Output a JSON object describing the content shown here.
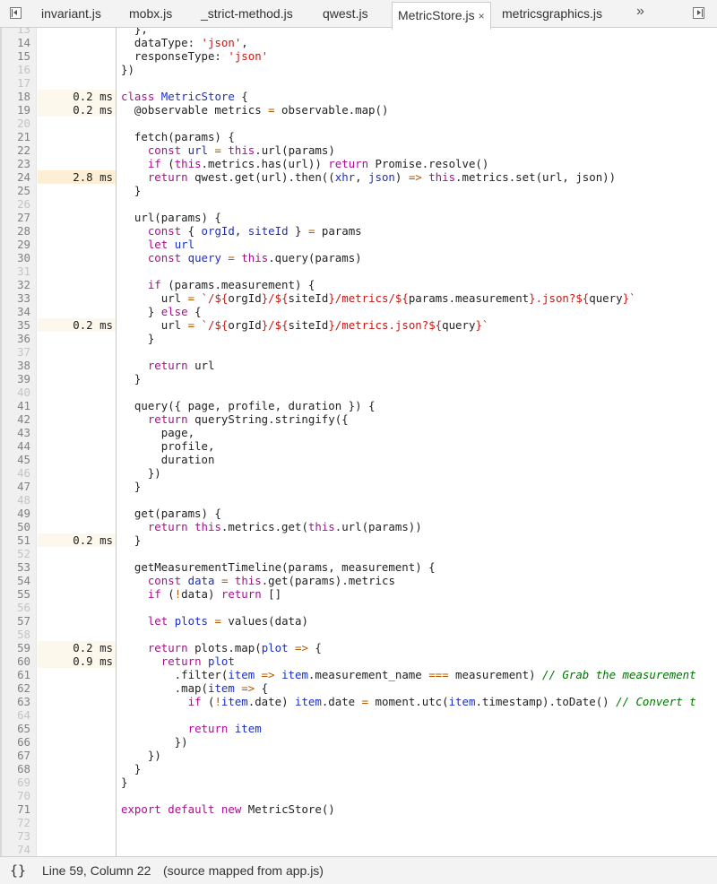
{
  "tabs": {
    "items": [
      {
        "label": "invariant.js",
        "active": false
      },
      {
        "label": "mobx.js",
        "active": false
      },
      {
        "label": "_strict-method.js",
        "active": false
      },
      {
        "label": "qwest.js",
        "active": false
      },
      {
        "label": "MetricStore.js",
        "active": true,
        "close": "×"
      },
      {
        "label": "metricsgraphics.js",
        "active": false
      }
    ],
    "more": "»"
  },
  "colors": {
    "keyword": "#aa0d91",
    "definition": "#1c2fbf",
    "string": "#c41a16",
    "operator": "#b35a00",
    "comment": "#007400",
    "hot_timing": "#fcefd6",
    "warm_timing": "#fdf8ec"
  },
  "code": {
    "lines": [
      {
        "n": "13",
        "dim": true,
        "t": [
          [
            "p",
            "  },"
          ]
        ]
      },
      {
        "n": "14",
        "t": [
          [
            "p",
            "  dataType: "
          ],
          [
            "s",
            "'json'"
          ],
          [
            "p",
            ","
          ]
        ]
      },
      {
        "n": "15",
        "t": [
          [
            "p",
            "  responseType: "
          ],
          [
            "s",
            "'json'"
          ]
        ]
      },
      {
        "n": "16",
        "dim": true,
        "t": [
          [
            "p",
            "})"
          ]
        ]
      },
      {
        "n": "17",
        "dim": true,
        "t": []
      },
      {
        "n": "18",
        "time": "0.2 ms",
        "heat": 1,
        "t": [
          [
            "k",
            "class"
          ],
          [
            "p",
            " "
          ],
          [
            "d",
            "MetricStore"
          ],
          [
            "p",
            " {"
          ]
        ]
      },
      {
        "n": "19",
        "time": "0.2 ms",
        "heat": 1,
        "t": [
          [
            "p",
            "  @observable metrics "
          ],
          [
            "o",
            "="
          ],
          [
            "p",
            " observable.map()"
          ]
        ]
      },
      {
        "n": "20",
        "dim": true,
        "t": []
      },
      {
        "n": "21",
        "t": [
          [
            "p",
            "  fetch(params) {"
          ]
        ]
      },
      {
        "n": "22",
        "t": [
          [
            "p",
            "    "
          ],
          [
            "k",
            "const"
          ],
          [
            "p",
            " "
          ],
          [
            "d",
            "url"
          ],
          [
            "p",
            " "
          ],
          [
            "o",
            "="
          ],
          [
            "p",
            " "
          ],
          [
            "k",
            "this"
          ],
          [
            "p",
            ".url(params)"
          ]
        ]
      },
      {
        "n": "23",
        "t": [
          [
            "p",
            "    "
          ],
          [
            "k",
            "if"
          ],
          [
            "p",
            " ("
          ],
          [
            "k",
            "this"
          ],
          [
            "p",
            ".metrics.has(url)) "
          ],
          [
            "k",
            "return"
          ],
          [
            "p",
            " Promise.resolve()"
          ]
        ]
      },
      {
        "n": "24",
        "time": "2.8 ms",
        "heat": 2,
        "t": [
          [
            "p",
            "    "
          ],
          [
            "k",
            "return"
          ],
          [
            "p",
            " qwest.get(url).then(("
          ],
          [
            "d",
            "xhr"
          ],
          [
            "p",
            ", "
          ],
          [
            "d",
            "json"
          ],
          [
            "p",
            ") "
          ],
          [
            "o",
            "=>"
          ],
          [
            "p",
            " "
          ],
          [
            "k",
            "this"
          ],
          [
            "p",
            ".metrics.set(url, json))"
          ]
        ]
      },
      {
        "n": "25",
        "t": [
          [
            "p",
            "  }"
          ]
        ]
      },
      {
        "n": "26",
        "dim": true,
        "t": []
      },
      {
        "n": "27",
        "t": [
          [
            "p",
            "  url(params) {"
          ]
        ]
      },
      {
        "n": "28",
        "t": [
          [
            "p",
            "    "
          ],
          [
            "k",
            "const"
          ],
          [
            "p",
            " { "
          ],
          [
            "d",
            "orgId"
          ],
          [
            "p",
            ", "
          ],
          [
            "d",
            "siteId"
          ],
          [
            "p",
            " } "
          ],
          [
            "o",
            "="
          ],
          [
            "p",
            " params"
          ]
        ]
      },
      {
        "n": "29",
        "t": [
          [
            "p",
            "    "
          ],
          [
            "k",
            "let"
          ],
          [
            "p",
            " "
          ],
          [
            "d",
            "url"
          ]
        ]
      },
      {
        "n": "30",
        "t": [
          [
            "p",
            "    "
          ],
          [
            "k",
            "const"
          ],
          [
            "p",
            " "
          ],
          [
            "d",
            "query"
          ],
          [
            "p",
            " "
          ],
          [
            "o",
            "="
          ],
          [
            "p",
            " "
          ],
          [
            "k",
            "this"
          ],
          [
            "p",
            ".query(params)"
          ]
        ]
      },
      {
        "n": "31",
        "dim": true,
        "t": []
      },
      {
        "n": "32",
        "t": [
          [
            "p",
            "    "
          ],
          [
            "k",
            "if"
          ],
          [
            "p",
            " (params.measurement) {"
          ]
        ]
      },
      {
        "n": "33",
        "t": [
          [
            "p",
            "      url "
          ],
          [
            "o",
            "="
          ],
          [
            "p",
            " "
          ],
          [
            "s",
            "`/${"
          ],
          [
            "p",
            "orgId"
          ],
          [
            "s",
            "}/${"
          ],
          [
            "p",
            "siteId"
          ],
          [
            "s",
            "}/metrics/${"
          ],
          [
            "p",
            "params.measurement"
          ],
          [
            "s",
            "}.json?${"
          ],
          [
            "p",
            "query"
          ],
          [
            "s",
            "}`"
          ]
        ]
      },
      {
        "n": "34",
        "t": [
          [
            "p",
            "    } "
          ],
          [
            "k",
            "else"
          ],
          [
            "p",
            " {"
          ]
        ]
      },
      {
        "n": "35",
        "time": "0.2 ms",
        "heat": 1,
        "t": [
          [
            "p",
            "      url "
          ],
          [
            "o",
            "="
          ],
          [
            "p",
            " "
          ],
          [
            "s",
            "`/${"
          ],
          [
            "p",
            "orgId"
          ],
          [
            "s",
            "}/${"
          ],
          [
            "p",
            "siteId"
          ],
          [
            "s",
            "}/metrics.json?${"
          ],
          [
            "p",
            "query"
          ],
          [
            "s",
            "}`"
          ]
        ]
      },
      {
        "n": "36",
        "t": [
          [
            "p",
            "    }"
          ]
        ]
      },
      {
        "n": "37",
        "dim": true,
        "t": []
      },
      {
        "n": "38",
        "t": [
          [
            "p",
            "    "
          ],
          [
            "k",
            "return"
          ],
          [
            "p",
            " url"
          ]
        ]
      },
      {
        "n": "39",
        "t": [
          [
            "p",
            "  }"
          ]
        ]
      },
      {
        "n": "40",
        "dim": true,
        "t": []
      },
      {
        "n": "41",
        "t": [
          [
            "p",
            "  query({ page, profile, duration }) {"
          ]
        ]
      },
      {
        "n": "42",
        "t": [
          [
            "p",
            "    "
          ],
          [
            "k",
            "return"
          ],
          [
            "p",
            " queryString.stringify({"
          ]
        ]
      },
      {
        "n": "43",
        "t": [
          [
            "p",
            "      page,"
          ]
        ]
      },
      {
        "n": "44",
        "t": [
          [
            "p",
            "      profile,"
          ]
        ]
      },
      {
        "n": "45",
        "t": [
          [
            "p",
            "      duration"
          ]
        ]
      },
      {
        "n": "46",
        "dim": true,
        "t": [
          [
            "p",
            "    })"
          ]
        ]
      },
      {
        "n": "47",
        "t": [
          [
            "p",
            "  }"
          ]
        ]
      },
      {
        "n": "48",
        "dim": true,
        "t": []
      },
      {
        "n": "49",
        "t": [
          [
            "p",
            "  get(params) {"
          ]
        ]
      },
      {
        "n": "50",
        "t": [
          [
            "p",
            "    "
          ],
          [
            "k",
            "return"
          ],
          [
            "p",
            " "
          ],
          [
            "k",
            "this"
          ],
          [
            "p",
            ".metrics.get("
          ],
          [
            "k",
            "this"
          ],
          [
            "p",
            ".url(params))"
          ]
        ]
      },
      {
        "n": "51",
        "time": "0.2 ms",
        "heat": 1,
        "t": [
          [
            "p",
            "  }"
          ]
        ]
      },
      {
        "n": "52",
        "dim": true,
        "t": []
      },
      {
        "n": "53",
        "t": [
          [
            "p",
            "  getMeasurementTimeline(params, measurement) {"
          ]
        ]
      },
      {
        "n": "54",
        "t": [
          [
            "p",
            "    "
          ],
          [
            "k",
            "const"
          ],
          [
            "p",
            " "
          ],
          [
            "d",
            "data"
          ],
          [
            "p",
            " "
          ],
          [
            "o",
            "="
          ],
          [
            "p",
            " "
          ],
          [
            "k",
            "this"
          ],
          [
            "p",
            ".get(params).metrics"
          ]
        ]
      },
      {
        "n": "55",
        "t": [
          [
            "p",
            "    "
          ],
          [
            "k",
            "if"
          ],
          [
            "p",
            " ("
          ],
          [
            "o",
            "!"
          ],
          [
            "p",
            "data) "
          ],
          [
            "k",
            "return"
          ],
          [
            "p",
            " []"
          ]
        ]
      },
      {
        "n": "56",
        "dim": true,
        "t": []
      },
      {
        "n": "57",
        "t": [
          [
            "p",
            "    "
          ],
          [
            "k",
            "let"
          ],
          [
            "p",
            " "
          ],
          [
            "d",
            "plots"
          ],
          [
            "p",
            " "
          ],
          [
            "o",
            "="
          ],
          [
            "p",
            " values(data)"
          ]
        ]
      },
      {
        "n": "58",
        "dim": true,
        "t": []
      },
      {
        "n": "59",
        "time": "0.2 ms",
        "heat": 1,
        "t": [
          [
            "p",
            "    "
          ],
          [
            "k",
            "return"
          ],
          [
            "p",
            " plots.map"
          ],
          [
            "u",
            "("
          ],
          [
            "d",
            "plot"
          ],
          [
            "p",
            " "
          ],
          [
            "o",
            "=>"
          ],
          [
            "p",
            " {"
          ]
        ]
      },
      {
        "n": "60",
        "time": "0.9 ms",
        "heat": 1,
        "t": [
          [
            "p",
            "      "
          ],
          [
            "k",
            "return"
          ],
          [
            "p",
            " "
          ],
          [
            "d",
            "plot"
          ]
        ]
      },
      {
        "n": "61",
        "t": [
          [
            "p",
            "        .filter("
          ],
          [
            "d",
            "item"
          ],
          [
            "p",
            " "
          ],
          [
            "o",
            "=>"
          ],
          [
            "p",
            " "
          ],
          [
            "d",
            "item"
          ],
          [
            "p",
            ".measurement_name "
          ],
          [
            "o",
            "==="
          ],
          [
            "p",
            " measurement) "
          ],
          [
            "c",
            "// Grab the measurement"
          ]
        ]
      },
      {
        "n": "62",
        "t": [
          [
            "p",
            "        .map("
          ],
          [
            "d",
            "item"
          ],
          [
            "p",
            " "
          ],
          [
            "o",
            "=>"
          ],
          [
            "p",
            " {"
          ]
        ]
      },
      {
        "n": "63",
        "t": [
          [
            "p",
            "          "
          ],
          [
            "k",
            "if"
          ],
          [
            "p",
            " ("
          ],
          [
            "o",
            "!"
          ],
          [
            "d",
            "item"
          ],
          [
            "p",
            ".date) "
          ],
          [
            "d",
            "item"
          ],
          [
            "p",
            ".date "
          ],
          [
            "o",
            "="
          ],
          [
            "p",
            " moment.utc("
          ],
          [
            "d",
            "item"
          ],
          [
            "p",
            ".timestamp).toDate() "
          ],
          [
            "c",
            "// Convert t"
          ]
        ]
      },
      {
        "n": "64",
        "dim": true,
        "t": []
      },
      {
        "n": "65",
        "t": [
          [
            "p",
            "          "
          ],
          [
            "k",
            "return"
          ],
          [
            "p",
            " "
          ],
          [
            "d",
            "item"
          ]
        ]
      },
      {
        "n": "66",
        "t": [
          [
            "p",
            "        })"
          ]
        ]
      },
      {
        "n": "67",
        "t": [
          [
            "p",
            "    }"
          ],
          [
            "u",
            ")"
          ]
        ]
      },
      {
        "n": "68",
        "t": [
          [
            "p",
            "  }"
          ]
        ]
      },
      {
        "n": "69",
        "dim": true,
        "t": [
          [
            "p",
            "}"
          ]
        ]
      },
      {
        "n": "70",
        "dim": true,
        "t": []
      },
      {
        "n": "71",
        "t": [
          [
            "k",
            "export"
          ],
          [
            "p",
            " "
          ],
          [
            "k",
            "default"
          ],
          [
            "p",
            " "
          ],
          [
            "k",
            "new"
          ],
          [
            "p",
            " MetricStore()"
          ]
        ]
      },
      {
        "n": "72",
        "dim": true,
        "t": []
      },
      {
        "n": "73",
        "dim": true,
        "t": []
      },
      {
        "n": "74",
        "dim": true,
        "t": []
      }
    ]
  },
  "status": {
    "format_icon": "{}",
    "position": "Line 59, Column 22",
    "source": "(source mapped from app.js)"
  }
}
